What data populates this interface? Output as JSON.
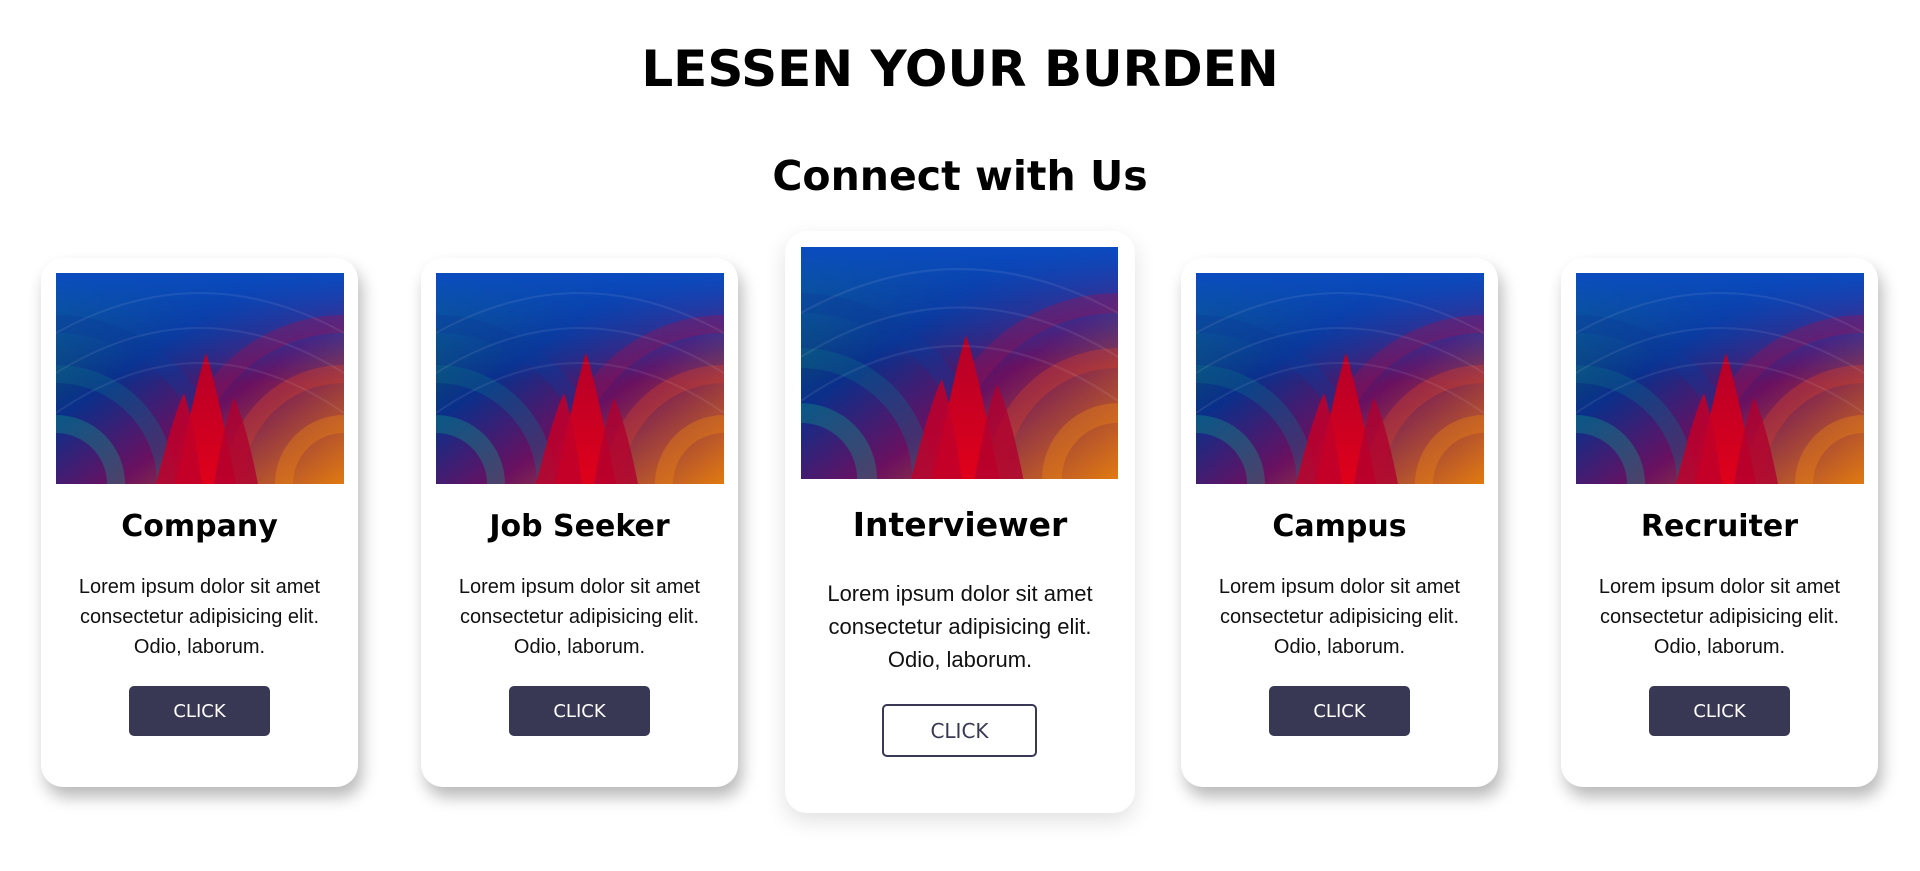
{
  "header": {
    "headline": "LESSEN YOUR BURDEN",
    "subheading": "Connect with Us"
  },
  "theme": {
    "button_color": "#383854",
    "card_background": "#ffffff",
    "image_palette": [
      "#0a4bc0",
      "#0a2f8a",
      "#0a7a6a",
      "#d6001c",
      "#e07a10",
      "#a0105a"
    ]
  },
  "cards": [
    {
      "title": "Company",
      "text": "Lorem ipsum dolor sit amet consectetur adipisicing elit. Odio, laborum.",
      "button_label": "CLICK",
      "image": "abstract-gradient-image"
    },
    {
      "title": "Job Seeker",
      "text": "Lorem ipsum dolor sit amet consectetur adipisicing elit. Odio, laborum.",
      "button_label": "CLICK",
      "image": "abstract-gradient-image"
    },
    {
      "title": "Interviewer",
      "text": "Lorem ipsum dolor sit amet consectetur adipisicing elit. Odio, laborum.",
      "button_label": "CLICK",
      "image": "abstract-gradient-image",
      "state": "hovered"
    },
    {
      "title": "Campus",
      "text": "Lorem ipsum dolor sit amet consectetur adipisicing elit. Odio, laborum.",
      "button_label": "CLICK",
      "image": "abstract-gradient-image"
    },
    {
      "title": "Recruiter",
      "text": "Lorem ipsum dolor sit amet consectetur adipisicing elit. Odio, laborum.",
      "button_label": "CLICK",
      "image": "abstract-gradient-image"
    }
  ]
}
